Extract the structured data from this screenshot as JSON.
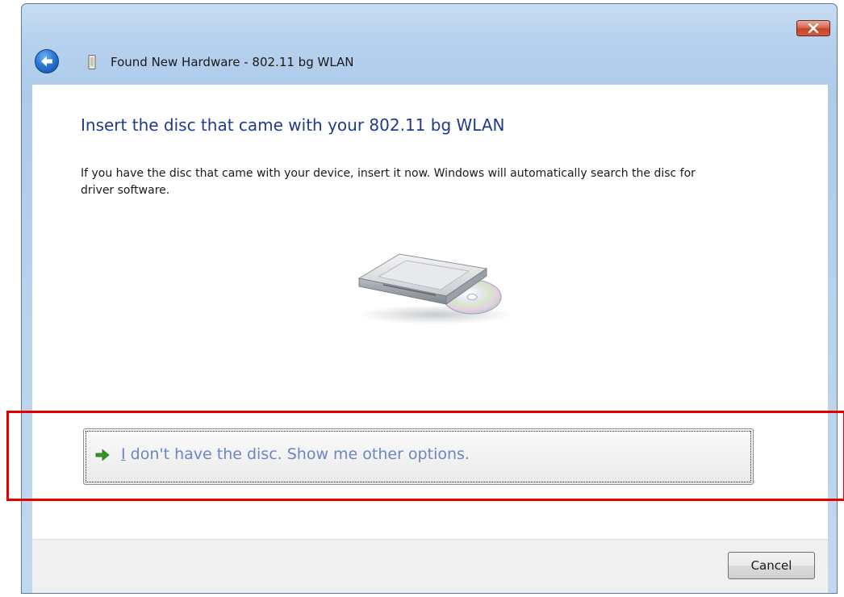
{
  "window": {
    "title": "Found New Hardware - 802.11 bg WLAN"
  },
  "content": {
    "heading": "Insert the disc that came with your 802.11 bg WLAN",
    "description": "If you have the disc that came with your device, insert it now.  Windows will automatically search the disc for driver software."
  },
  "command_link": {
    "accelerator": "I",
    "label_rest": " don't have the disc.  Show me other options."
  },
  "footer": {
    "cancel_label": "Cancel"
  },
  "icons": {
    "back": "back-arrow-icon",
    "device": "device-icon",
    "close": "close-icon",
    "disc": "disc-drive-icon",
    "command_arrow": "green-arrow-icon"
  },
  "colors": {
    "heading": "#1e3c8c",
    "command_link_text": "#6a86c4",
    "highlight": "#e10000"
  }
}
